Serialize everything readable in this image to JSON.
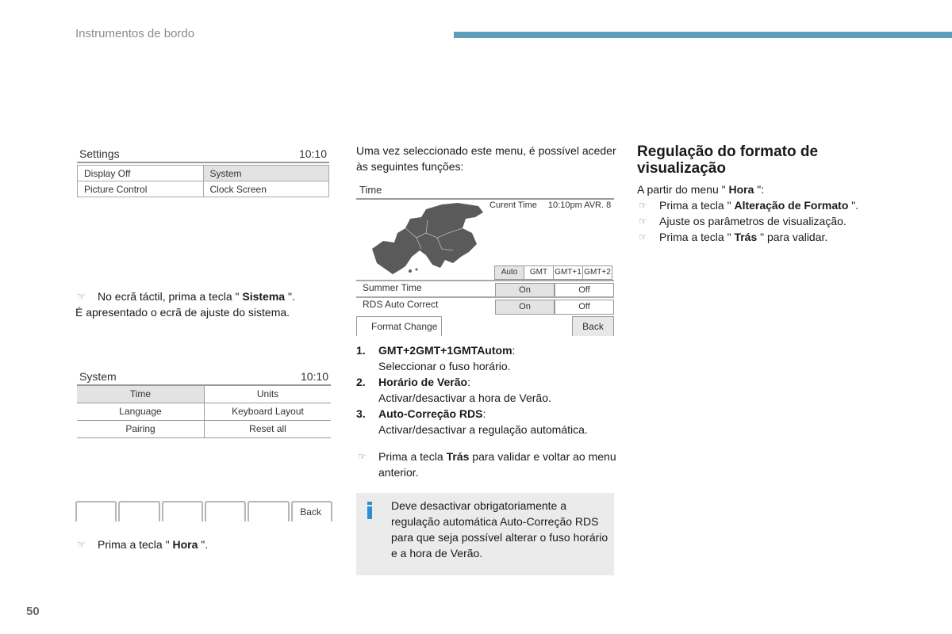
{
  "header": {
    "section_title": "Instrumentos de bordo",
    "accent_color": "#5b9fb8"
  },
  "page_number": "50",
  "settings_screen": {
    "title": "Settings",
    "clock": "10:10",
    "cells": [
      "Display Off",
      "System",
      "Picture Control",
      "Clock Screen"
    ],
    "selected": "System"
  },
  "step_system": {
    "prefix": "No ecrã táctil, prima a tecla \" ",
    "key": "Sistema",
    "suffix": " \".",
    "result": "É apresentado o ecrã de ajuste do sistema."
  },
  "system_screen": {
    "title": "System",
    "clock": "10:10",
    "rows": [
      [
        "Time",
        "Units"
      ],
      [
        "Language",
        "Keyboard Layout"
      ],
      [
        "Pairing",
        "Reset all"
      ]
    ],
    "selected": "Time"
  },
  "softkeys": {
    "keys": [
      "",
      "",
      "",
      "",
      "",
      "Back"
    ]
  },
  "step_hora": {
    "prefix": "Prima a tecla \" ",
    "key": "Hora",
    "suffix": " \"."
  },
  "intro": {
    "text": "Uma vez seleccionado este menu, é possível aceder às seguintes funções:"
  },
  "time_screen": {
    "title": "Time",
    "map_icon": "europe-map",
    "current_time_label": "Curent Time",
    "current_time_value": "10:10pm AVR. 8",
    "timezones": [
      "Auto",
      "GMT",
      "GMT+1",
      "GMT+2"
    ],
    "timezone_selected": "Auto",
    "rows": [
      {
        "label": "Summer Time",
        "on": "On",
        "off": "Off",
        "selected": "On"
      },
      {
        "label": "RDS Auto Correct",
        "on": "On",
        "off": "Off",
        "selected": "On"
      }
    ],
    "format_change": "Format Change",
    "back": "Back"
  },
  "functions": [
    {
      "num": "1.",
      "title": "GMT+2GMT+1GMTAutom",
      "desc": "Seleccionar o fuso horário."
    },
    {
      "num": "2.",
      "title": "Horário de Verão",
      "desc": "Activar/desactivar a hora de Verão."
    },
    {
      "num": "3.",
      "title": "Auto-Correção RDS",
      "desc": "Activar/desactivar a regulação automática."
    }
  ],
  "step_tras": {
    "prefix": "Prima a tecla ",
    "key": "Trás",
    "suffix": " para validar e voltar ao menu anterior."
  },
  "note": {
    "icon": "info-icon",
    "icon_color": "#2d8fcf",
    "text": "Deve desactivar obrigatoriamente a regulação automática Auto-Correção RDS para que seja possível alterar o fuso horário e a hora de Verão."
  },
  "format_section": {
    "title": "Regulação do formato de visualização",
    "intro_prefix": "A partir do menu \" ",
    "intro_key": "Hora",
    "intro_suffix": " \":",
    "steps": [
      {
        "prefix": "Prima a tecla \" ",
        "key": "Alteração de Formato",
        "suffix": " \"."
      },
      {
        "prefix": "Ajuste os parâmetros de visualização.",
        "key": "",
        "suffix": ""
      },
      {
        "prefix": "Prima a tecla \" ",
        "key": "Trás",
        "suffix": " \" para validar."
      }
    ]
  },
  "bullet_glyph": "☞"
}
